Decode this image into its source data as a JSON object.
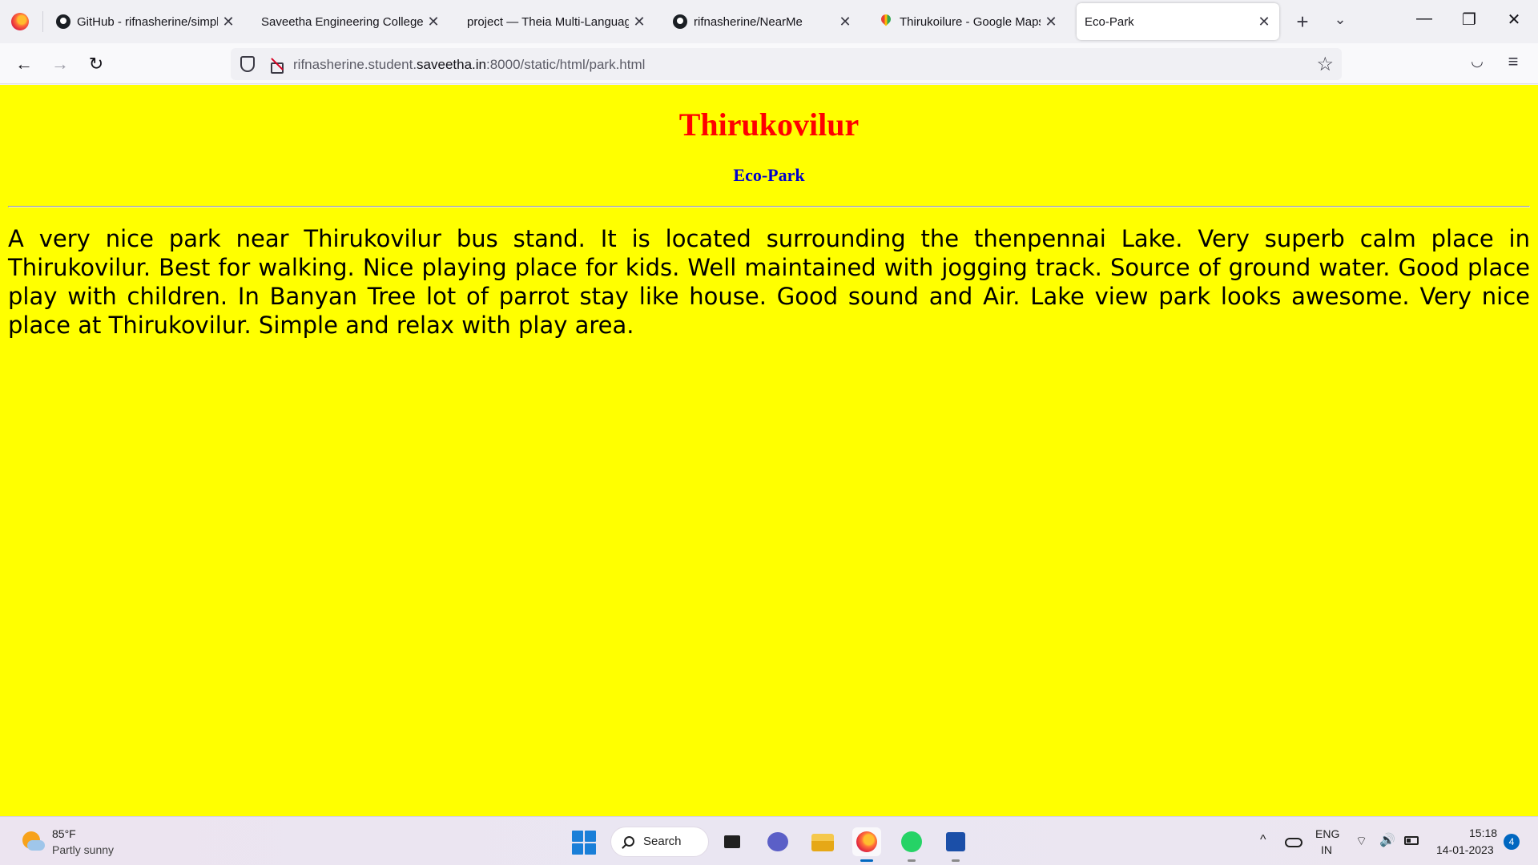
{
  "browser": {
    "tabs": [
      {
        "label": "GitHub - rifnasherine/simple",
        "icon": "github-icon"
      },
      {
        "label": "Saveetha Engineering College",
        "icon": ""
      },
      {
        "label": "project — Theia Multi-Language",
        "icon": ""
      },
      {
        "label": "rifnasherine/NearMe",
        "icon": "github-icon"
      },
      {
        "label": "Thirukoilure - Google Maps",
        "icon": "google-maps-icon"
      },
      {
        "label": "Eco-Park",
        "icon": ""
      }
    ],
    "url": {
      "prefix": "rifnasherine.student.",
      "host": "saveetha.in",
      "suffix": ":8000/static/html/park.html"
    },
    "glyphs": {
      "close": "✕",
      "plus": "+",
      "list": "⌄",
      "minimize": "—",
      "restore": "❐",
      "back": "←",
      "forward": "→",
      "reload": "↻",
      "star": "☆",
      "pocket": "◡",
      "menu": "≡"
    }
  },
  "page": {
    "title": "Thirukovilur",
    "subtitle": "Eco-Park",
    "paragraph": "A very nice park near Thirukovilur bus stand. It is located surrounding the thenpennai Lake. Very superb calm place in Thirukovilur. Best for walking. Nice playing place for kids. Well maintained with jogging track. Source of ground water. Good place play with children. In Banyan Tree lot of parrot stay like house. Good sound and Air. Lake view park looks awesome. Very nice place at Thirukovilur. Simple and relax with play area.",
    "colors": {
      "background": "#ffff00",
      "title": "#ff0000",
      "subtitle": "#0000cc",
      "rule": "#ff0000"
    }
  },
  "taskbar": {
    "weather": {
      "temp": "85°F",
      "desc": "Partly sunny"
    },
    "search_label": "Search",
    "tray": {
      "chevron": "^",
      "lang_line1": "ENG",
      "lang_line2": "IN",
      "wifi": "⌔",
      "sound": "🔊",
      "time": "15:18",
      "date": "14-01-2023",
      "notifications": "4"
    }
  }
}
